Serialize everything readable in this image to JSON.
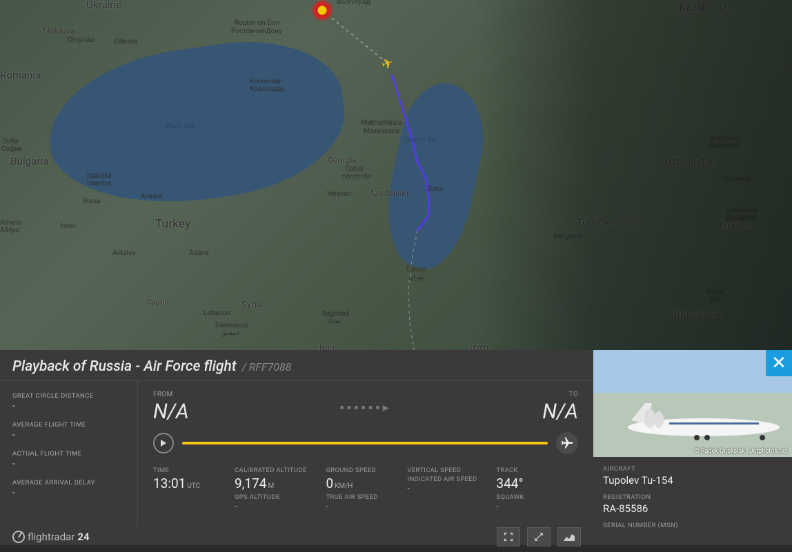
{
  "map": {
    "countries": {
      "ukraine": "Ukraine",
      "kazakhstan": "Kazakhstan",
      "moldova": "Moldova",
      "romania": "Romania",
      "bulgaria": "Bulgaria",
      "georgia": "Georgia",
      "uzbekistan": "Uzbekistan",
      "turkmenistan": "Turkmenistan",
      "tajikistan": "Tajikistan",
      "turkey": "Turkey",
      "azerbaijan": "Azerbaijan",
      "iran": "Iran",
      "afghanistan": "Afghanistan",
      "syria": "Syria",
      "iraq": "Iraq",
      "cyprus": "Cyprus"
    },
    "cities": {
      "rostov": "Rostov-on-Don",
      "rostov_cyr": "Ростов-на-Дону",
      "volgograd_cyr": "Волгоград",
      "chisinau": "Chișinău",
      "odessa": "Odessa",
      "krasnodar": "Krasnodar",
      "krasnodar_cyr": "Краснодар",
      "makhachkala": "Makhachkala",
      "makhachkala_cyr": "Махачкала",
      "tbilisi": "Tbilisi",
      "tbilisi_geo": "თბილისი",
      "baku": "Baku",
      "istanbul": "Istanbul",
      "istanbul_tr": "İstanbul",
      "bursa": "Bursa",
      "ankara": "Ankara",
      "izmir": "İzmir",
      "antalya": "Antalya",
      "adana": "Adana",
      "tashkent": "Tashkent",
      "shymkent": "Shymkent",
      "shymkent_cyr": "Шымкент",
      "dushanbe": "Dushanbe",
      "dushanbe_cyr": "Душанбе",
      "ashgabat": "Ashgabat",
      "sofia": "Sofia",
      "sofia_cyr": "София",
      "athens": "Athens",
      "athens_gr": "Αθήνα",
      "lebanon": "Lebanon",
      "damascus": "Damascus",
      "damascus_ar": "دمشق",
      "baghdad": "Baghdad",
      "baghdad_ar": "بغداد",
      "tehran": "Tehran",
      "tehran_fa": "تهران",
      "kabul": "Kabul",
      "kabul_fa": "کابل",
      "yerevan": "Yerevan"
    },
    "seas": {
      "black": "Black Sea",
      "caspian": "Caspian Sea"
    }
  },
  "title": {
    "main": "Playback of Russia - Air Force flight",
    "sub": "/ RFF7088"
  },
  "stats": {
    "gcd_label": "GREAT CIRCLE DISTANCE",
    "gcd_value": "-",
    "aft_label": "AVERAGE FLIGHT TIME",
    "aft_value": "-",
    "actual_label": "ACTUAL FLIGHT TIME",
    "actual_value": "-",
    "delay_label": "AVERAGE ARRIVAL DELAY",
    "delay_value": "-"
  },
  "route": {
    "from_label": "FROM",
    "from_value": "N/A",
    "to_label": "TO",
    "to_value": "N/A"
  },
  "telemetry": {
    "time_label": "TIME",
    "time_value": "13:01",
    "time_unit": "UTC",
    "calt_label": "CALIBRATED ALTITUDE",
    "calt_value": "9,174",
    "calt_unit": "M",
    "gps_label": "GPS ALTITUDE",
    "gps_value": "-",
    "gspeed_label": "GROUND SPEED",
    "gspeed_value": "0",
    "gspeed_unit": "KM/H",
    "tas_label": "TRUE AIR SPEED",
    "tas_value": "-",
    "vspeed_label": "VERTICAL SPEED",
    "vspeed_value": "-",
    "ias_label": "INDICATED AIR SPEED",
    "ias_value": "-",
    "track_label": "TRACK",
    "track_value": "344°",
    "squawk_label": "SQUAWK",
    "squawk_value": "-"
  },
  "aircraft": {
    "type_label": "AIRCRAFT",
    "type_value": "Tupolev Tu-154",
    "reg_label": "REGISTRATION",
    "reg_value": "RA-85586",
    "msn_label": "SERIAL NUMBER (MSN)",
    "msn_value": ""
  },
  "photo_credit": "© Radek Oneksiak | Jetphotos.net",
  "brand": {
    "name1": "flightradar",
    "name2": "24"
  }
}
